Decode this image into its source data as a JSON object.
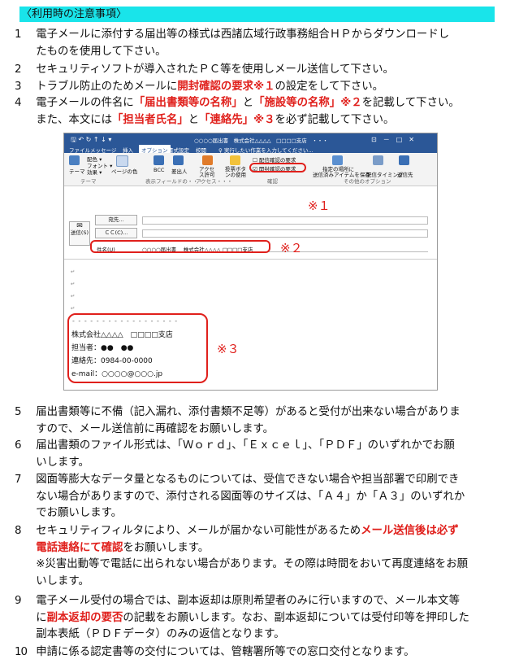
{
  "header": "〈利用時の注意事項〉",
  "items": [
    {
      "num": "1",
      "lines": [
        [
          {
            "t": "電子メールに添付する届出等の様式は西諸広域行政事務組合ＨＰからダウンロードし"
          }
        ],
        [
          {
            "t": "たものを使用して下さい。"
          }
        ]
      ]
    },
    {
      "num": "2",
      "lines": [
        [
          {
            "t": "セキュリティソフトが導入されたＰＣ等を使用しメール送信して下さい。"
          }
        ]
      ]
    },
    {
      "num": "3",
      "lines": [
        [
          {
            "t": "トラブル防止のためメールに"
          },
          {
            "t": "開封確認の要求※１",
            "r": 1
          },
          {
            "t": "の設定をして下さい。"
          }
        ]
      ]
    },
    {
      "num": "4",
      "lines": [
        [
          {
            "t": "電子メールの件名に"
          },
          {
            "t": "「届出書類等の名称」",
            "r": 1
          },
          {
            "t": "と"
          },
          {
            "t": "「施設等の名称」※２",
            "r": 1
          },
          {
            "t": "を記載して下さい。"
          }
        ],
        [
          {
            "t": "また、本文には"
          },
          {
            "t": "「担当者氏名」",
            "r": 1
          },
          {
            "t": "と"
          },
          {
            "t": "「連絡先」※３",
            "r": 1
          },
          {
            "t": "を必ず記載して下さい。"
          }
        ]
      ]
    },
    {
      "num": "5",
      "lines": [
        [
          {
            "t": "届出書類等に不備（記入漏れ、添付書類不足等）があると受付が出来ない場合がありま"
          }
        ],
        [
          {
            "t": "すので、メール送信前に再確認をお願いします。"
          }
        ]
      ]
    },
    {
      "num": "6",
      "lines": [
        [
          {
            "t": "届出書類のファイル形式は、「Ｗｏｒｄ」、「Ｅｘｃｅｌ」、「ＰＤＦ」のいずれかでお願"
          }
        ],
        [
          {
            "t": "いします。"
          }
        ]
      ]
    },
    {
      "num": "7",
      "lines": [
        [
          {
            "t": "図面等膨大なデータ量となるものについては、受信できない場合や担当部署で印刷でき"
          }
        ],
        [
          {
            "t": "ない場合がありますので、添付される図面等のサイズは、「Ａ４」か「Ａ３」のいずれか"
          }
        ],
        [
          {
            "t": "でお願いします。"
          }
        ]
      ]
    },
    {
      "num": "8",
      "lines": [
        [
          {
            "t": "セキュリティフィルタにより、メールが届かない可能性があるため"
          },
          {
            "t": "メール送信後は必ず",
            "r": 1
          }
        ],
        [
          {
            "t": "電話連絡にて確認",
            "r": 1
          },
          {
            "t": "をお願いします。"
          }
        ],
        [
          {
            "t": "※災害出動等で電話に出られない場合があります。その際は時間をおいて再度連絡をお願"
          }
        ],
        [
          {
            "t": "いします。"
          }
        ]
      ]
    },
    {
      "num": "9",
      "lines": [
        [
          {
            "t": "電子メール受付の場合では、副本返却は原則希望者のみに行いますので、メール本文等"
          }
        ],
        [
          {
            "t": "に"
          },
          {
            "t": "副本返却の要否",
            "r": 1
          },
          {
            "t": "の記載をお願いします。なお、副本返却については受付印等を押印した"
          }
        ],
        [
          {
            "t": "副本表紙（ＰＤＦデータ）のみの返信となります。"
          }
        ]
      ]
    },
    {
      "num": "10",
      "lines": [
        [
          {
            "t": "申請に係る認定書等の交付については、管轄署所等での窓口交付となります。"
          }
        ]
      ]
    }
  ],
  "screenshot": {
    "title": "○○○○届出書　株式会社△△△△　□□□□支店　・・・",
    "tabs": [
      "ファイル",
      "メッセージ",
      "挿入",
      "オプション",
      "書式設定",
      "校閲"
    ],
    "tell_me": "♀ 実行したい作業を入力してください...",
    "ribbon": {
      "theme_label": "テーマ",
      "colors": "配色 ▾",
      "fonts": "フォント ▾",
      "effects": "効果 ▾",
      "page_color": "ページの色",
      "bcc": "BCC",
      "from": "差出人",
      "permission": "アクセス許可",
      "voting": "投票ボタンの使用",
      "delivery_receipt": "配信確認の要求",
      "read_receipt": "開封確認の要求",
      "save_sent": "送信済みアイテムを保存",
      "delay": "配信タイミング",
      "direct_replies": "返信先",
      "group_theme": "テーマ",
      "group_show": "表示フィールドの・・・",
      "group_access": "アクセス・・・",
      "group_confirm": "確認",
      "group_other": "その他のオプション",
      "store_sent": "指定の場所に"
    },
    "to_label": "宛先...",
    "cc_label": "ＣＣ(C)...",
    "subject_label": "件名(U)",
    "subject_value": "○○○○届出書　 株式会社△△△△ □□□□支店",
    "send_label": "送信(S)",
    "sig_company": "株式会社△△△△　□□□□支店",
    "sig_person": "担当者：●●　●●",
    "sig_phone": "連絡先：0984-00-0000",
    "sig_email": "e-mail：○○○○@○○○.jp",
    "mark1": "※１",
    "mark2": "※２",
    "mark3": "※３"
  },
  "colors": {
    "accent": "#19e4ea",
    "emphasis": "#e0201c",
    "outlook_blue": "#2b5797"
  }
}
